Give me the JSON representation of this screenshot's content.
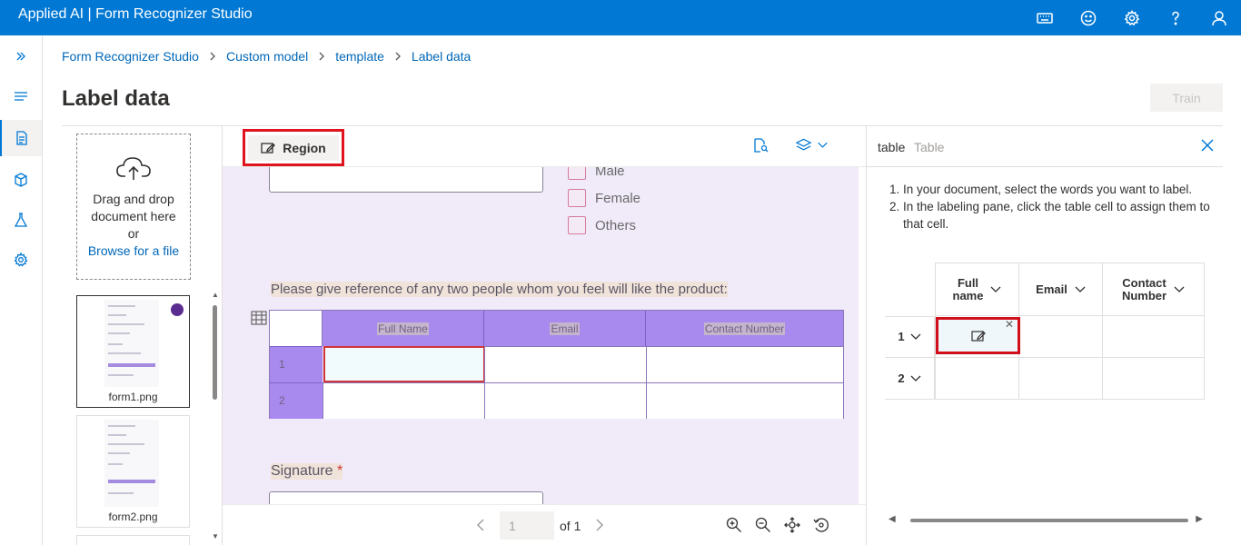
{
  "app": {
    "title": "Applied AI | Form Recognizer Studio"
  },
  "topbar_icons": [
    "keyboard-icon",
    "feedback-smiley-icon",
    "settings-gear-icon",
    "help-question-icon",
    "account-person-icon"
  ],
  "rail": [
    "expand-chevrons-icon",
    "menu-hamburger-icon",
    "document-icon",
    "cube-icon",
    "flask-icon",
    "settings-icon"
  ],
  "breadcrumb": [
    "Form Recognizer Studio",
    "Custom model",
    "template",
    "Label data"
  ],
  "page": {
    "title": "Label data",
    "train_label": "Train"
  },
  "dropzone": {
    "line1": "Drag and drop",
    "line2": "document here",
    "line3": "or",
    "link": "Browse for a file"
  },
  "files": [
    {
      "name": "form1.png",
      "selected": true,
      "labeled_dot_color": "#5c2d91"
    },
    {
      "name": "form2.png",
      "selected": false
    }
  ],
  "viewer": {
    "region_label": "Region",
    "checkboxes": [
      "Male",
      "Female",
      "Others"
    ],
    "reference_text": "Please give reference of any two people whom you feel will like the product:",
    "table_headers": [
      "Full Name",
      "Email",
      "Contact Number"
    ],
    "row_numbers": [
      "1",
      "2"
    ],
    "signature_label": "Signature",
    "signature_required": "*",
    "page_value": "1",
    "page_of": "of 1"
  },
  "right_pane": {
    "title": "table",
    "subtitle": "Table",
    "instruction_1": "In your document, select the words you want to label.",
    "instruction_2": "In the labeling pane, click the table cell to assign them to that cell.",
    "columns": [
      {
        "line1": "Full",
        "line2": "name"
      },
      {
        "line1": "Email",
        "line2": ""
      },
      {
        "line1": "Contact",
        "line2": "Number"
      }
    ],
    "rows": [
      "1",
      "2"
    ]
  },
  "colors": {
    "topbar": "#0078d4",
    "accent": "#0078d4",
    "highlight_red": "#e0141e",
    "doc_table_header": "#a889ee"
  }
}
